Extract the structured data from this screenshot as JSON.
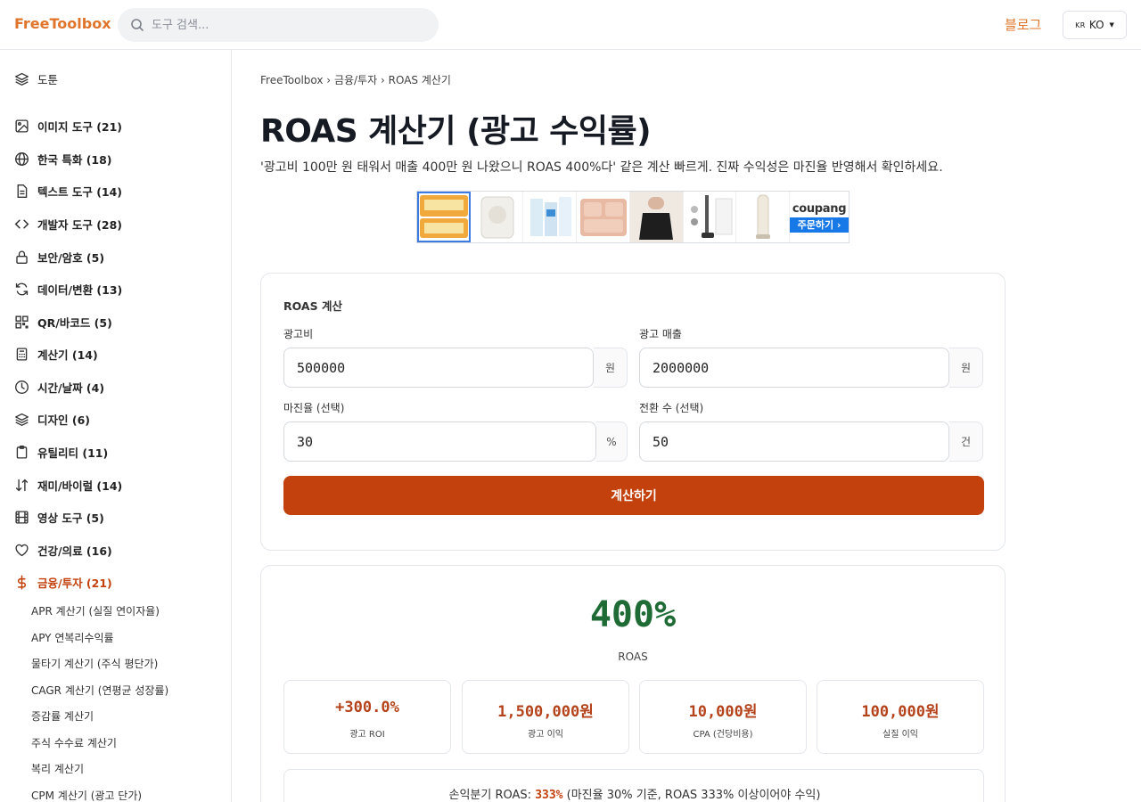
{
  "header": {
    "logo": "FreeToolbox",
    "search_placeholder": "도구 검색...",
    "blog_label": "블로그",
    "lang_flag": "KR",
    "lang_label": "KO"
  },
  "sidebar": {
    "items": [
      {
        "label": "도툰",
        "icon": "layers-icon"
      },
      {
        "label": "이미지 도구 (21)",
        "icon": "image-icon"
      },
      {
        "label": "한국 특화 (18)",
        "icon": "globe-icon"
      },
      {
        "label": "텍스트 도구 (14)",
        "icon": "document-icon"
      },
      {
        "label": "개발자 도구 (28)",
        "icon": "code-icon"
      },
      {
        "label": "보안/암호 (5)",
        "icon": "lock-icon"
      },
      {
        "label": "데이터/변환 (13)",
        "icon": "refresh-icon"
      },
      {
        "label": "QR/바코드 (5)",
        "icon": "qr-icon"
      },
      {
        "label": "계산기 (14)",
        "icon": "calculator-icon"
      },
      {
        "label": "시간/날짜 (4)",
        "icon": "clock-icon"
      },
      {
        "label": "디자인 (6)",
        "icon": "layers-icon"
      },
      {
        "label": "유틸리티 (11)",
        "icon": "clipboard-icon"
      },
      {
        "label": "재미/바이럴 (14)",
        "icon": "sort-icon"
      },
      {
        "label": "영상 도구 (5)",
        "icon": "film-icon"
      },
      {
        "label": "건강/의료 (16)",
        "icon": "heart-icon"
      },
      {
        "label": "금융/투자 (21)",
        "icon": "dollar-icon"
      }
    ],
    "sub_items": [
      "APR 계산기 (실질 연이자율)",
      "APY 연복리수익률",
      "물타기 계산기 (주식 평단가)",
      "CAGR 계산기 (연평균 성장률)",
      "증감률 계산기",
      "주식 수수료 계산기",
      "복리 계산기",
      "CPM 계산기 (광고 단가)"
    ]
  },
  "breadcrumb": {
    "home": "FreeToolbox",
    "category": "금융/투자",
    "current": "ROAS 계산기",
    "sep": "›"
  },
  "page": {
    "title": "ROAS 계산기 (광고 수익률)",
    "description": "'광고비 100만 원 태워서 매출 400만 원 나왔으니 ROAS 400%다' 같은 계산 빠르게. 진짜 수익성은 마진율 반영해서 확인하세요."
  },
  "banner": {
    "brand": "coupang",
    "button": "주문하기 ›"
  },
  "form": {
    "title": "ROAS 계산",
    "ad_cost": {
      "label": "광고비",
      "value": "500000",
      "unit": "원"
    },
    "ad_revenue": {
      "label": "광고 매출",
      "value": "2000000",
      "unit": "원"
    },
    "margin": {
      "label": "마진율 (선택)",
      "value": "30",
      "unit": "%"
    },
    "conversions": {
      "label": "전환 수 (선택)",
      "value": "50",
      "unit": "건"
    },
    "submit_label": "계산하기"
  },
  "result": {
    "roas_value": "400%",
    "roas_label": "ROAS",
    "metrics": [
      {
        "value": "+300.0%",
        "unit": "",
        "label": "광고 ROI"
      },
      {
        "value": "1,500,000",
        "unit": "원",
        "label": "광고 이익"
      },
      {
        "value": "10,000",
        "unit": "원",
        "label": "CPA (건당비용)"
      },
      {
        "value": "100,000",
        "unit": "원",
        "label": "실질 이익"
      }
    ],
    "breakeven_prefix": "손익분기 ROAS: ",
    "breakeven_value": "333%",
    "breakeven_suffix": " (마진율 30% 기준, ROAS 333% 이상이어야 수익)"
  },
  "colors": {
    "accent": "#c2410c",
    "logo": "#e0742a",
    "roas_green": "#1f6b35"
  }
}
